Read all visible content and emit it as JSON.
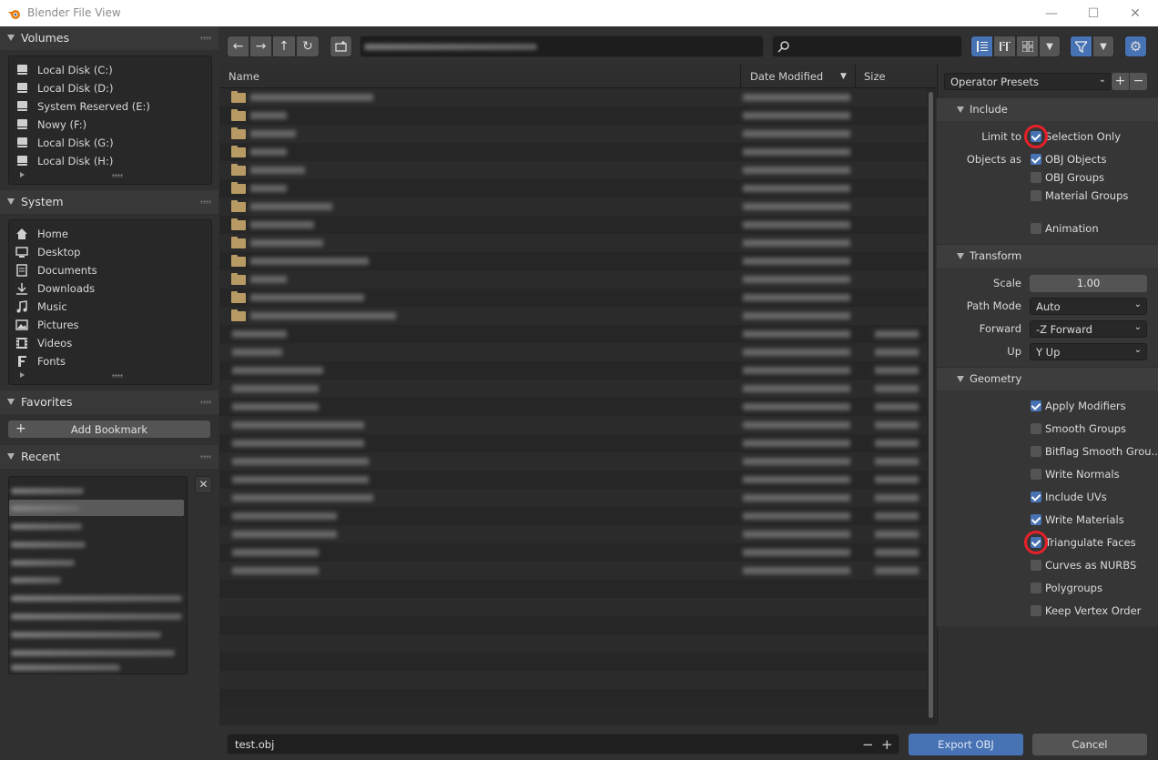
{
  "window": {
    "title": "Blender File View",
    "minimize": "—",
    "maximize": "☐",
    "close": "✕"
  },
  "sidebar": {
    "volumes": {
      "title": "Volumes",
      "items": [
        {
          "label": "Local Disk (C:)",
          "icon": "drive-icon"
        },
        {
          "label": "Local Disk (D:)",
          "icon": "drive-icon"
        },
        {
          "label": "System Reserved (E:)",
          "icon": "drive-icon"
        },
        {
          "label": "Nowy (F:)",
          "icon": "drive-icon"
        },
        {
          "label": "Local Disk (G:)",
          "icon": "drive-icon"
        },
        {
          "label": "Local Disk (H:)",
          "icon": "drive-icon"
        }
      ]
    },
    "system": {
      "title": "System",
      "items": [
        {
          "label": "Home",
          "icon": "home-icon"
        },
        {
          "label": "Desktop",
          "icon": "desktop-icon"
        },
        {
          "label": "Documents",
          "icon": "documents-icon"
        },
        {
          "label": "Downloads",
          "icon": "downloads-icon"
        },
        {
          "label": "Music",
          "icon": "music-icon"
        },
        {
          "label": "Pictures",
          "icon": "pictures-icon"
        },
        {
          "label": "Videos",
          "icon": "videos-icon"
        },
        {
          "label": "Fonts",
          "icon": "fonts-icon"
        }
      ]
    },
    "favorites": {
      "title": "Favorites",
      "add_bookmark": "Add Bookmark"
    },
    "recent": {
      "title": "Recent",
      "clear": "✕"
    }
  },
  "filelist": {
    "columns": {
      "name": "Name",
      "date": "Date Modified",
      "size": "Size"
    },
    "sort_indicator": "▼"
  },
  "bottom": {
    "filename": "test.obj",
    "minus": "−",
    "plus": "+",
    "export_label": "Export OBJ",
    "cancel_label": "Cancel"
  },
  "options": {
    "presets_label": "Operator Presets",
    "include": {
      "title": "Include",
      "limit_to_label": "Limit to",
      "objects_as_label": "Objects as",
      "checks": [
        {
          "label": "Selection Only",
          "checked": true
        },
        {
          "label": "OBJ Objects",
          "checked": true
        },
        {
          "label": "OBJ Groups",
          "checked": false
        },
        {
          "label": "Material Groups",
          "checked": false
        },
        {
          "label": "Animation",
          "checked": false
        }
      ]
    },
    "transform": {
      "title": "Transform",
      "scale_label": "Scale",
      "scale_value": "1.00",
      "path_mode_label": "Path Mode",
      "path_mode_value": "Auto",
      "forward_label": "Forward",
      "forward_value": "-Z Forward",
      "up_label": "Up",
      "up_value": "Y Up"
    },
    "geometry": {
      "title": "Geometry",
      "checks": [
        {
          "label": "Apply Modifiers",
          "checked": true
        },
        {
          "label": "Smooth Groups",
          "checked": false
        },
        {
          "label": "Bitflag Smooth Grou...",
          "checked": false
        },
        {
          "label": "Write Normals",
          "checked": false
        },
        {
          "label": "Include UVs",
          "checked": true
        },
        {
          "label": "Write Materials",
          "checked": true
        },
        {
          "label": "Triangulate Faces",
          "checked": true
        },
        {
          "label": "Curves as NURBS",
          "checked": false
        },
        {
          "label": "Polygroups",
          "checked": false
        },
        {
          "label": "Keep Vertex Order",
          "checked": false
        }
      ]
    }
  },
  "colors": {
    "accent": "#4772b3",
    "highlight_ring": "#e8202a",
    "folder": "#b89b64"
  }
}
